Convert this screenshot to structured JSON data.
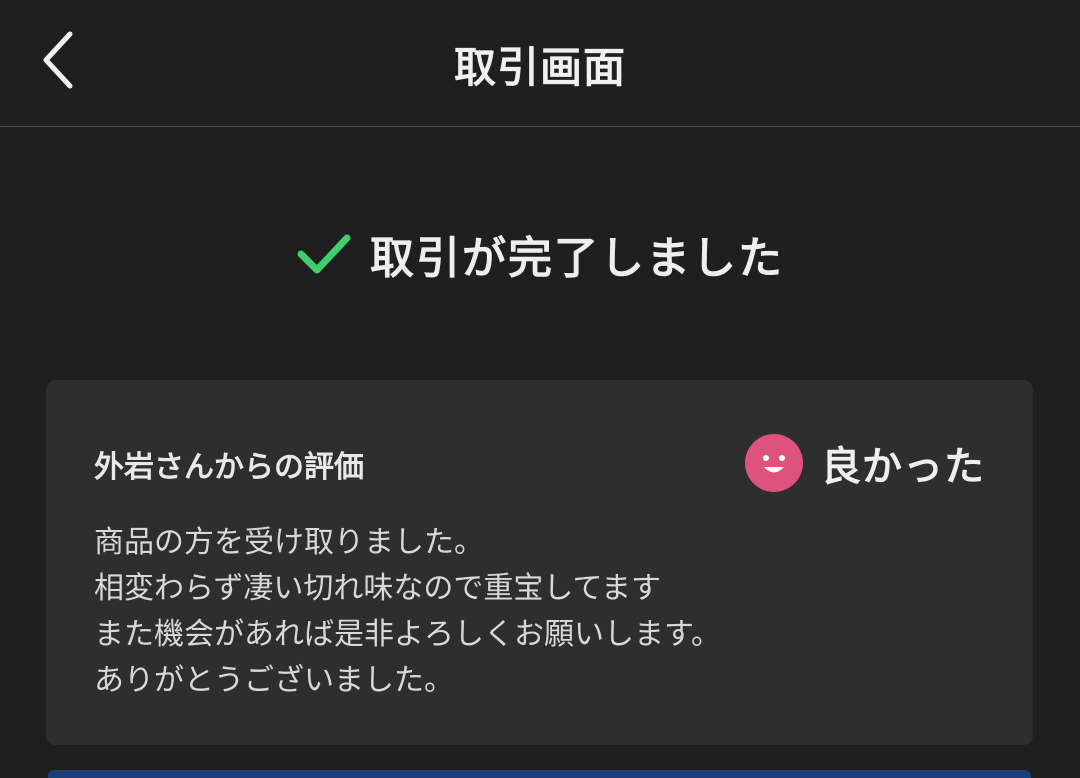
{
  "nav": {
    "title": "取引画面",
    "back_icon": "chevron-left-icon"
  },
  "status": {
    "icon": "checkmark-icon",
    "icon_color": "#3ecf6a",
    "text": "取引が完了しました"
  },
  "review": {
    "heading": "外岩さんからの評価",
    "rating_icon": "smile-face-icon",
    "rating_icon_color": "#e0527e",
    "rating_label": "良かった",
    "lines": [
      "商品の方を受け取りました。",
      "相変わらず凄い切れ味なので重宝してます",
      "また機会があれば是非よろしくお願いします。",
      "ありがとうございました。"
    ]
  }
}
